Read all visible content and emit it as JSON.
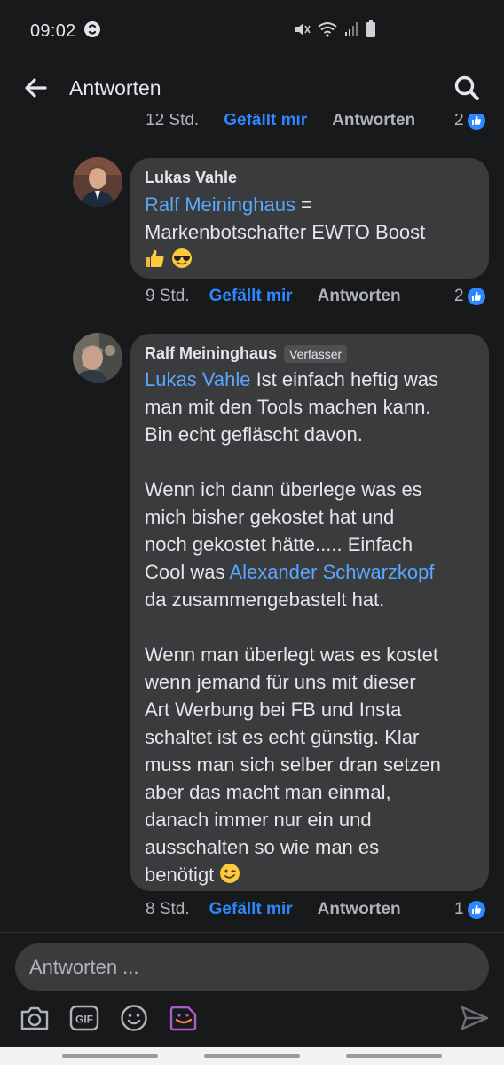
{
  "status_bar": {
    "time": "09:02",
    "icons": [
      "shazam-icon",
      "mute-icon",
      "wifi-icon",
      "signal-icon",
      "battery-icon"
    ]
  },
  "app_bar": {
    "title": "Antworten",
    "back_icon": "arrow-left-icon",
    "search_icon": "search-icon"
  },
  "comments": [
    {
      "time": "12 Std.",
      "like_label": "Gefällt mir",
      "reply_label": "Antworten",
      "likes": "2"
    },
    {
      "author": "Lukas Vahle",
      "mention": "Ralf Meininghaus",
      "text_after_mention": " =",
      "text_line2": "Markenbotschafter EWTO Boost",
      "emojis": [
        "thumbs-up-emoji",
        "sunglasses-emoji"
      ],
      "time": "9 Std.",
      "like_label": "Gefällt mir",
      "reply_label": "Antworten",
      "likes": "2"
    },
    {
      "author": "Ralf Meininghaus",
      "author_badge": "Verfasser",
      "mention1": "Lukas Vahle",
      "para1_line1_rest": " Ist einfach heftig was",
      "para1_line2": "man mit den Tools machen kann.",
      "para1_line3": "Bin echt gefläscht davon.",
      "para2_line1": "Wenn ich dann überlege was es",
      "para2_line2": "mich bisher gekostet hat und",
      "para2_line3": "noch gekostet hätte..... Einfach",
      "para2_line4_pre": "Cool was ",
      "mention2": "Alexander Schwarzkopf",
      "para2_line5": "da zusammengebastelt hat.",
      "para3_line1": "Wenn man überlegt was es kostet",
      "para3_line2": "wenn jemand für uns mit dieser",
      "para3_line3": "Art Werbung bei FB und Insta",
      "para3_line4": "schaltet ist es echt günstig. Klar",
      "para3_line5": "muss man sich selber dran setzen",
      "para3_line6": "aber das macht man einmal,",
      "para3_line7": "danach immer nur ein und",
      "para3_line8": "ausschalten so wie man es",
      "para3_line9": "benötigt",
      "emoji": "winking-face-emoji",
      "time": "8 Std.",
      "like_label": "Gefällt mir",
      "reply_label": "Antworten",
      "likes": "1"
    }
  ],
  "composer": {
    "placeholder": "Antworten ...",
    "tools": [
      "camera-icon",
      "gif-icon",
      "emoji-smiley-icon",
      "sticker-icon"
    ],
    "send_icon": "send-icon"
  },
  "colors": {
    "background": "#18191a",
    "bubble": "#3a3b3c",
    "accent_blue": "#2d88ff",
    "mention_blue": "#5aa7ff",
    "muted_text": "#b0b3b8",
    "sticker_purple": "#a85cc9"
  }
}
